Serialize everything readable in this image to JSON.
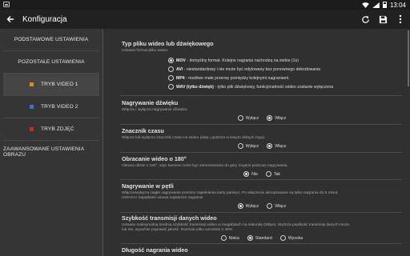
{
  "status_bar": {
    "time": "13:04"
  },
  "app_bar": {
    "title": "Konfiguracja"
  },
  "sidebar": {
    "items": [
      {
        "label": "PODSTAWOWE USTAWIENIA"
      },
      {
        "label": "POZOSTAŁE USTAWIENIA"
      },
      {
        "label": "TRYB VIDEO 1",
        "color": "#e08a1e"
      },
      {
        "label": "TRYB VIDEO 2",
        "color": "#3f6fd8"
      },
      {
        "label": "TRYB ZDJĘĆ",
        "color": "#c62828"
      },
      {
        "label": "ZAAWANSOWANE USTAWIENIA OBRAZU"
      }
    ]
  },
  "sections": {
    "file_type": {
      "title": "Typ pliku wideo lub dźwiękowego",
      "desc": "Ustawia format pliku wideo.",
      "options": [
        {
          "name": "MOV",
          "text": " - domyślny format. Kolejne nagrania nachodzą na siebie (1s)",
          "selected": true
        },
        {
          "name": "AVI",
          "text": " - niestandardowy i nie może być edytowany bez ponownego dekodowania",
          "selected": false
        },
        {
          "name": "MP4",
          "text": " - możliwe małe przerwy pomiędzy kolejnymi nagraniami.",
          "selected": false
        },
        {
          "name": "WAV (tylko dźwięk)",
          "text": " - tylko plik dźwiękowy, funkcjonalność wideo zostanie wyłączona",
          "selected": false
        }
      ]
    },
    "audio": {
      "title": "Nagrywanie dźwięku",
      "desc": "Włącza / wyłącza nagrywanie dźwięku.",
      "opt1": "Wyłącz",
      "opt2": "Włącz"
    },
    "timestamp": {
      "title": "Znacznik czasu",
      "desc": "Włącza lub wyłącza znacznik czasu na wideo (data i godzina w lewym dolnym rogu).",
      "opt1": "Wyłącz",
      "opt2": "Włącz"
    },
    "rotate": {
      "title": "Obracanie wideo o 180°",
      "desc": "Obraca obraz o 180°, więc kamera może być zamontowana do góry nogami podczas nagrywania.",
      "opt1": "Nie",
      "opt2": "Tak"
    },
    "loop": {
      "title": "Nagrywanie w pętli",
      "desc1": "Włącza/wyłącza ciągłe nagrywanie pomimo zapełnienia karty pamięci. Po włączeniu akceptowane są tylko nagrania do 5 minut.",
      "desc2": "UWAGA! Zapętlanie usuwa najstarsze nagranie",
      "opt1": "Wyłącz",
      "opt2": "Włącz"
    },
    "bitrate": {
      "title": "Szybkość transmisji danych wideo",
      "desc1": "Ustawia maksymalną średnią szybkość transmisji wideo w megabitach na sekundę (Mbps). Wyższa prędkość transmisji danych może,",
      "desc2": "lub nie, wyraźnie poprawić jakość. Rozmiar pliku wzrośnie o 40%.",
      "opt1": "Niska",
      "opt2": "Standard",
      "opt3": "Wysoka"
    },
    "length": {
      "title": "Długość nagrania wideo"
    }
  }
}
